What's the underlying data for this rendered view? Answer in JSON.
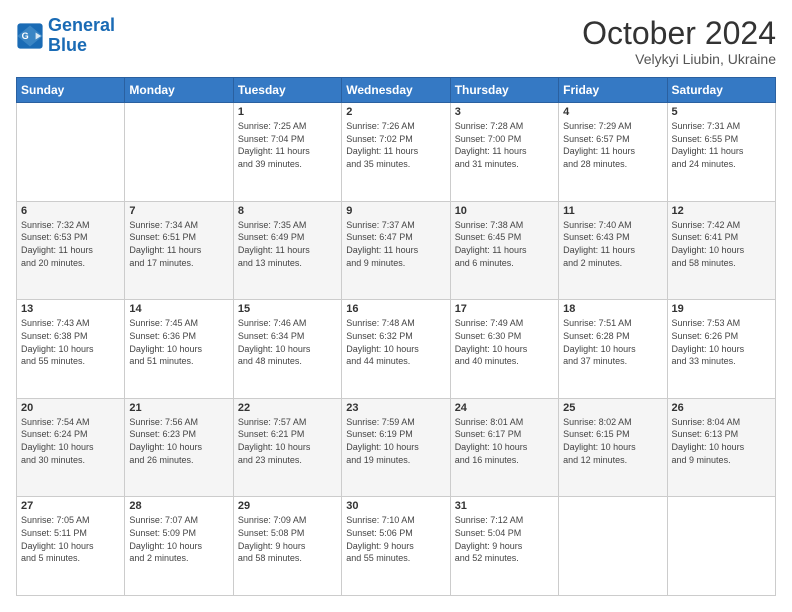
{
  "header": {
    "logo_line1": "General",
    "logo_line2": "Blue",
    "title": "October 2024",
    "subtitle": "Velykyi Liubin, Ukraine"
  },
  "calendar": {
    "headers": [
      "Sunday",
      "Monday",
      "Tuesday",
      "Wednesday",
      "Thursday",
      "Friday",
      "Saturday"
    ],
    "rows": [
      [
        {
          "day": "",
          "info": ""
        },
        {
          "day": "",
          "info": ""
        },
        {
          "day": "1",
          "info": "Sunrise: 7:25 AM\nSunset: 7:04 PM\nDaylight: 11 hours\nand 39 minutes."
        },
        {
          "day": "2",
          "info": "Sunrise: 7:26 AM\nSunset: 7:02 PM\nDaylight: 11 hours\nand 35 minutes."
        },
        {
          "day": "3",
          "info": "Sunrise: 7:28 AM\nSunset: 7:00 PM\nDaylight: 11 hours\nand 31 minutes."
        },
        {
          "day": "4",
          "info": "Sunrise: 7:29 AM\nSunset: 6:57 PM\nDaylight: 11 hours\nand 28 minutes."
        },
        {
          "day": "5",
          "info": "Sunrise: 7:31 AM\nSunset: 6:55 PM\nDaylight: 11 hours\nand 24 minutes."
        }
      ],
      [
        {
          "day": "6",
          "info": "Sunrise: 7:32 AM\nSunset: 6:53 PM\nDaylight: 11 hours\nand 20 minutes."
        },
        {
          "day": "7",
          "info": "Sunrise: 7:34 AM\nSunset: 6:51 PM\nDaylight: 11 hours\nand 17 minutes."
        },
        {
          "day": "8",
          "info": "Sunrise: 7:35 AM\nSunset: 6:49 PM\nDaylight: 11 hours\nand 13 minutes."
        },
        {
          "day": "9",
          "info": "Sunrise: 7:37 AM\nSunset: 6:47 PM\nDaylight: 11 hours\nand 9 minutes."
        },
        {
          "day": "10",
          "info": "Sunrise: 7:38 AM\nSunset: 6:45 PM\nDaylight: 11 hours\nand 6 minutes."
        },
        {
          "day": "11",
          "info": "Sunrise: 7:40 AM\nSunset: 6:43 PM\nDaylight: 11 hours\nand 2 minutes."
        },
        {
          "day": "12",
          "info": "Sunrise: 7:42 AM\nSunset: 6:41 PM\nDaylight: 10 hours\nand 58 minutes."
        }
      ],
      [
        {
          "day": "13",
          "info": "Sunrise: 7:43 AM\nSunset: 6:38 PM\nDaylight: 10 hours\nand 55 minutes."
        },
        {
          "day": "14",
          "info": "Sunrise: 7:45 AM\nSunset: 6:36 PM\nDaylight: 10 hours\nand 51 minutes."
        },
        {
          "day": "15",
          "info": "Sunrise: 7:46 AM\nSunset: 6:34 PM\nDaylight: 10 hours\nand 48 minutes."
        },
        {
          "day": "16",
          "info": "Sunrise: 7:48 AM\nSunset: 6:32 PM\nDaylight: 10 hours\nand 44 minutes."
        },
        {
          "day": "17",
          "info": "Sunrise: 7:49 AM\nSunset: 6:30 PM\nDaylight: 10 hours\nand 40 minutes."
        },
        {
          "day": "18",
          "info": "Sunrise: 7:51 AM\nSunset: 6:28 PM\nDaylight: 10 hours\nand 37 minutes."
        },
        {
          "day": "19",
          "info": "Sunrise: 7:53 AM\nSunset: 6:26 PM\nDaylight: 10 hours\nand 33 minutes."
        }
      ],
      [
        {
          "day": "20",
          "info": "Sunrise: 7:54 AM\nSunset: 6:24 PM\nDaylight: 10 hours\nand 30 minutes."
        },
        {
          "day": "21",
          "info": "Sunrise: 7:56 AM\nSunset: 6:23 PM\nDaylight: 10 hours\nand 26 minutes."
        },
        {
          "day": "22",
          "info": "Sunrise: 7:57 AM\nSunset: 6:21 PM\nDaylight: 10 hours\nand 23 minutes."
        },
        {
          "day": "23",
          "info": "Sunrise: 7:59 AM\nSunset: 6:19 PM\nDaylight: 10 hours\nand 19 minutes."
        },
        {
          "day": "24",
          "info": "Sunrise: 8:01 AM\nSunset: 6:17 PM\nDaylight: 10 hours\nand 16 minutes."
        },
        {
          "day": "25",
          "info": "Sunrise: 8:02 AM\nSunset: 6:15 PM\nDaylight: 10 hours\nand 12 minutes."
        },
        {
          "day": "26",
          "info": "Sunrise: 8:04 AM\nSunset: 6:13 PM\nDaylight: 10 hours\nand 9 minutes."
        }
      ],
      [
        {
          "day": "27",
          "info": "Sunrise: 7:05 AM\nSunset: 5:11 PM\nDaylight: 10 hours\nand 5 minutes."
        },
        {
          "day": "28",
          "info": "Sunrise: 7:07 AM\nSunset: 5:09 PM\nDaylight: 10 hours\nand 2 minutes."
        },
        {
          "day": "29",
          "info": "Sunrise: 7:09 AM\nSunset: 5:08 PM\nDaylight: 9 hours\nand 58 minutes."
        },
        {
          "day": "30",
          "info": "Sunrise: 7:10 AM\nSunset: 5:06 PM\nDaylight: 9 hours\nand 55 minutes."
        },
        {
          "day": "31",
          "info": "Sunrise: 7:12 AM\nSunset: 5:04 PM\nDaylight: 9 hours\nand 52 minutes."
        },
        {
          "day": "",
          "info": ""
        },
        {
          "day": "",
          "info": ""
        }
      ]
    ]
  }
}
